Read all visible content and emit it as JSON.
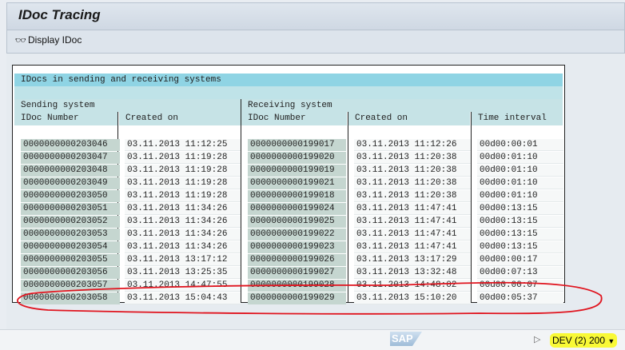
{
  "window": {
    "title": "IDoc Tracing"
  },
  "toolbar": {
    "display_idoc": "Display IDoc"
  },
  "table": {
    "header": "IDocs in sending and receiving systems",
    "groups": {
      "sending": "Sending system",
      "receiving": "Receiving system"
    },
    "columns": [
      "IDoc Number",
      "Created on",
      "IDoc Number",
      "Created on",
      "Time interval"
    ],
    "rows": [
      [
        "0000000000203046",
        "03.11.2013 11:12:25",
        "0000000000199017",
        "03.11.2013 11:12:26",
        "00d00:00:01"
      ],
      [
        "0000000000203047",
        "03.11.2013 11:19:28",
        "0000000000199020",
        "03.11.2013 11:20:38",
        "00d00:01:10"
      ],
      [
        "0000000000203048",
        "03.11.2013 11:19:28",
        "0000000000199019",
        "03.11.2013 11:20:38",
        "00d00:01:10"
      ],
      [
        "0000000000203049",
        "03.11.2013 11:19:28",
        "0000000000199021",
        "03.11.2013 11:20:38",
        "00d00:01:10"
      ],
      [
        "0000000000203050",
        "03.11.2013 11:19:28",
        "0000000000199018",
        "03.11.2013 11:20:38",
        "00d00:01:10"
      ],
      [
        "0000000000203051",
        "03.11.2013 11:34:26",
        "0000000000199024",
        "03.11.2013 11:47:41",
        "00d00:13:15"
      ],
      [
        "0000000000203052",
        "03.11.2013 11:34:26",
        "0000000000199025",
        "03.11.2013 11:47:41",
        "00d00:13:15"
      ],
      [
        "0000000000203053",
        "03.11.2013 11:34:26",
        "0000000000199022",
        "03.11.2013 11:47:41",
        "00d00:13:15"
      ],
      [
        "0000000000203054",
        "03.11.2013 11:34:26",
        "0000000000199023",
        "03.11.2013 11:47:41",
        "00d00:13:15"
      ],
      [
        "0000000000203055",
        "03.11.2013 13:17:12",
        "0000000000199026",
        "03.11.2013 13:17:29",
        "00d00:00:17"
      ],
      [
        "0000000000203056",
        "03.11.2013 13:25:35",
        "0000000000199027",
        "03.11.2013 13:32:48",
        "00d00:07:13"
      ],
      [
        "0000000000203057",
        "03.11.2013 14:47:55",
        "0000000000199028",
        "03.11.2013 14:48:02",
        "00d00:00:07"
      ],
      [
        "0000000000203058",
        "03.11.2013 15:04:43",
        "0000000000199029",
        "03.11.2013 15:10:20",
        "00d00:05:37"
      ]
    ]
  },
  "status": {
    "logo": "SAP",
    "system": "DEV (2) 200"
  },
  "colors": {
    "annotation": "#e0141e",
    "highlight": "#f9f936",
    "header": "#8fd4e4"
  }
}
